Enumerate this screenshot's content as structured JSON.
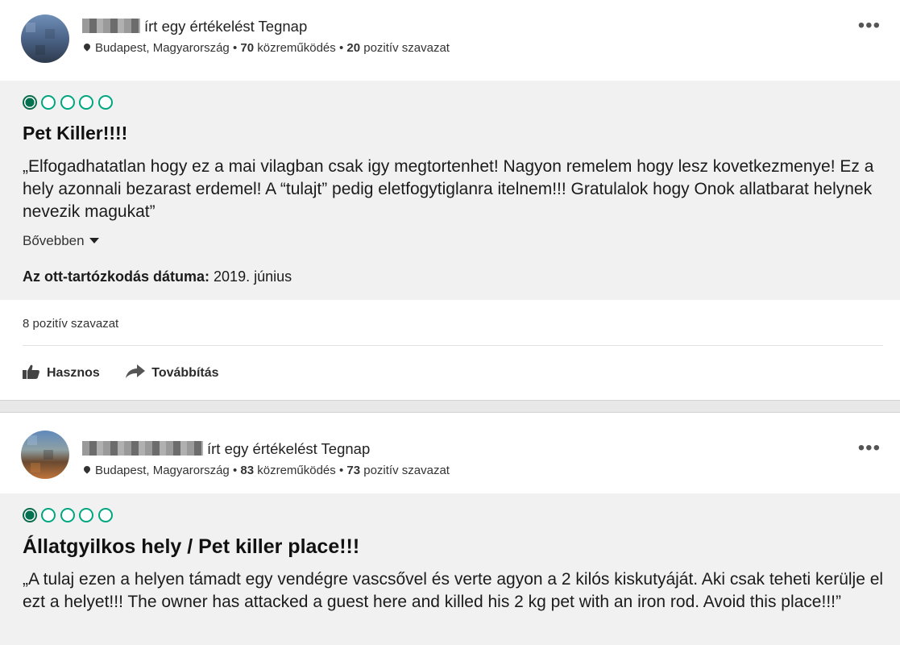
{
  "reviews": [
    {
      "author_suffix": "írt egy értékelést Tegnap",
      "location": "Budapest, Magyarország",
      "contributions": "70",
      "contributions_label": "közreműködés",
      "helpful_votes": "20",
      "helpful_votes_label": "pozitív szavazat",
      "rating_bubbles": 1,
      "title": "Pet Killer!!!!",
      "text": "„Elfogadhatatlan hogy ez a mai vilagban csak igy megtortenhet! Nagyon remelem hogy lesz kovetkezmenye! Ez a hely azonnali bezarast erdemel! A “tulajt” pedig eletfogytiglanra itelnem!!! Gratulalok hogy Onok allatbarat helynek nevezik magukat”",
      "read_more": "Bővebben",
      "date_label": "Az ott-tartózkodás dátuma:",
      "date_value": "2019. június",
      "votes_text": "8 pozitív szavazat",
      "helpful_button": "Hasznos",
      "share_button": "Továbbítás"
    },
    {
      "author_suffix": "írt egy értékelést Tegnap",
      "location": "Budapest, Magyarország",
      "contributions": "83",
      "contributions_label": "közreműködés",
      "helpful_votes": "73",
      "helpful_votes_label": "pozitív szavazat",
      "rating_bubbles": 1,
      "title": "Állatgyilkos hely / Pet killer place!!!",
      "text": "„A tulaj ezen a helyen támadt egy vendégre vascsővel és verte agyon a 2 kilós kiskutyáját. Aki csak teheti kerülje el ezt a helyet!!! The owner has attacked a guest here and killed his 2 kg pet with an iron rod. Avoid this place!!!”"
    }
  ],
  "colors": {
    "bubble_green": "#00a680",
    "bubble_fill": "#00724f",
    "panel_gray": "#f1f1f1"
  },
  "meta_separator": "•",
  "more_menu": "•••"
}
